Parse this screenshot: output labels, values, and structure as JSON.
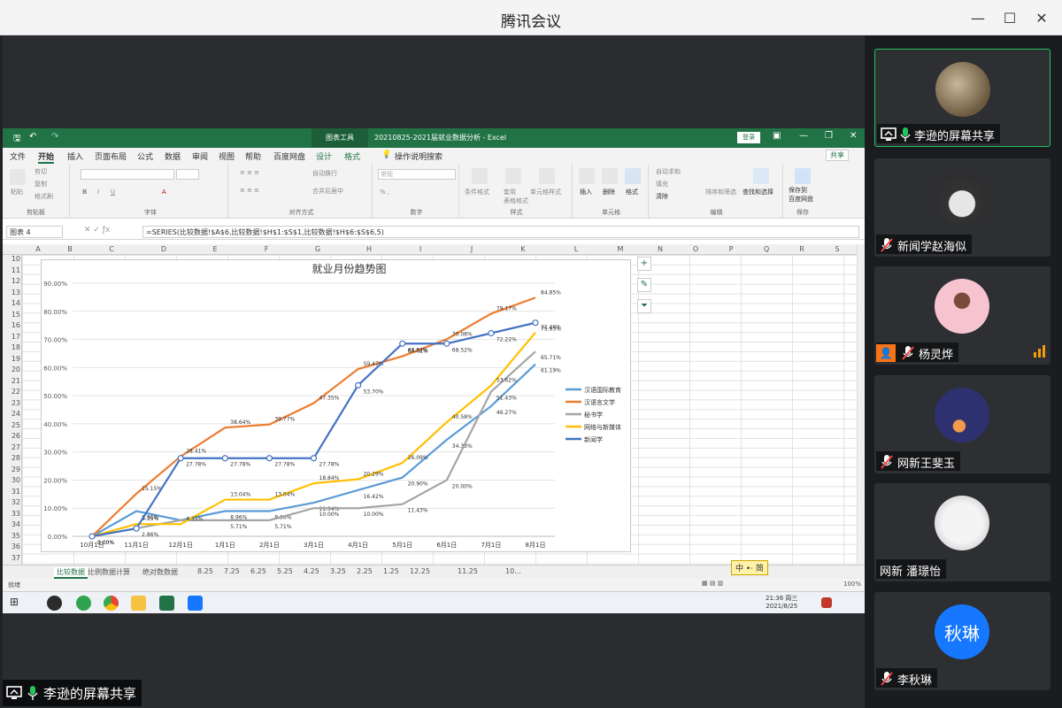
{
  "window": {
    "title": "腾讯会议",
    "minimize_glyph": "—",
    "maximize_glyph": "☐",
    "close_glyph": "✕"
  },
  "excel": {
    "context_tab": "图表工具",
    "doc_title": "20210825-2021届就业数据分析 - Excel",
    "login": "登录",
    "tabs": [
      "文件",
      "开始",
      "插入",
      "页面布局",
      "公式",
      "数据",
      "审阅",
      "视图",
      "帮助",
      "百度网盘",
      "设计",
      "格式"
    ],
    "tell_me": "操作说明搜索",
    "share": "共享",
    "ribbon_groups": [
      "剪贴板",
      "字体",
      "对齐方式",
      "数字",
      "样式",
      "单元格",
      "编辑",
      "保存"
    ],
    "ribbon_buttons": {
      "paste": "粘贴",
      "cut": "剪切",
      "copy": "复制",
      "format_painter": "格式刷",
      "wrap": "自动换行",
      "merge": "合并后居中",
      "number_format": "常规",
      "cond_format": "条件格式",
      "table_format": "套用\n表格格式",
      "cell_style": "单元格样式",
      "insert": "插入",
      "delete": "删除",
      "format": "格式",
      "autosum": "自动求和",
      "fill": "填充",
      "clear": "清除",
      "sort": "排序和筛选",
      "find": "查找和选择",
      "save_baidu": "保存到\n百度网盘"
    },
    "name_box": "图表 4",
    "formula": "=SERIES(比较数据!$A$6,比较数据!$H$1:$S$1,比较数据!$H$6:$S$6,5)",
    "columns": [
      "A",
      "B",
      "C",
      "D",
      "E",
      "F",
      "G",
      "H",
      "I",
      "J",
      "K",
      "L",
      "M",
      "N",
      "O",
      "P",
      "Q",
      "R",
      "S"
    ],
    "rows": [
      "10",
      "11",
      "12",
      "13",
      "14",
      "15",
      "16",
      "17",
      "18",
      "19",
      "20",
      "21",
      "22",
      "23",
      "24",
      "25",
      "26",
      "27",
      "28",
      "29",
      "30",
      "31",
      "32",
      "33",
      "34",
      "35",
      "36",
      "37"
    ],
    "sheet_tabs": [
      "比较数据",
      "比例数据计算",
      "绝对数数据",
      "8.25",
      "7.25",
      "6.25",
      "5.25",
      "4.25",
      "3.25",
      "2.25",
      "1.25",
      "12.25",
      "11.25",
      "10..."
    ],
    "status_left": "就绪",
    "zoom": "100%",
    "ime": "中 •· 简",
    "clock_time": "21:36 周三",
    "clock_date": "2021/8/25"
  },
  "chart_data": {
    "type": "line",
    "title": "就业月份趋势图",
    "categories": [
      "10月1日",
      "11月1日",
      "12月1日",
      "1月1日",
      "2月1日",
      "3月1日",
      "4月1日",
      "5月1日",
      "6月1日",
      "7月1日",
      "8月1日"
    ],
    "ylim": [
      0,
      90
    ],
    "yticks": [
      "0.00%",
      "10.00%",
      "20.00%",
      "30.00%",
      "40.00%",
      "50.00%",
      "60.00%",
      "70.00%",
      "80.00%",
      "90.00%"
    ],
    "grid": true,
    "legend_position": "right",
    "series": [
      {
        "name": "汉语国际教育",
        "color": "#5b9bd5",
        "values": [
          0.0,
          8.96,
          5.71,
          8.96,
          8.96,
          11.94,
          16.42,
          20.9,
          34.33,
          46.27,
          61.19
        ],
        "labels": [
          "0.00%",
          "8.96%",
          "",
          "8.96%",
          "8.96%",
          "11.94%",
          "16.42%",
          "20.90%",
          "34.33%",
          "46.27%",
          "61.19%"
        ]
      },
      {
        "name": "汉语言文学",
        "color": "#ed7d31",
        "values": [
          0.0,
          15.15,
          28.41,
          38.64,
          39.77,
          47.35,
          59.47,
          64.02,
          70.08,
          79.17,
          84.85
        ],
        "labels": [
          "",
          "15.15%",
          "28.41%",
          "38.64%",
          "39.77%",
          "47.35%",
          "59.47%",
          "64.02%",
          "70.08%",
          "79.17%",
          "84.85%"
        ]
      },
      {
        "name": "秘书学",
        "color": "#a5a5a5",
        "values": [
          0.0,
          2.86,
          5.71,
          5.71,
          5.71,
          10.0,
          10.0,
          11.43,
          20.0,
          51.43,
          65.71
        ],
        "labels": [
          "",
          "2.86%",
          "",
          "5.71%",
          "5.71%",
          "10.00%",
          "10.00%",
          "11.43%",
          "20.00%",
          "51.43%",
          "65.71%"
        ]
      },
      {
        "name": "网络与新媒体",
        "color": "#ffc000",
        "values": [
          0.0,
          4.35,
          4.35,
          13.04,
          13.04,
          18.84,
          20.29,
          26.09,
          40.58,
          53.62,
          72.46
        ],
        "labels": [
          "",
          "4.35%",
          "4.35%",
          "13.04%",
          "13.04%",
          "18.84%",
          "20.29%",
          "26.09%",
          "40.58%",
          "53.62%",
          "72.46%"
        ]
      },
      {
        "name": "新闻学",
        "color": "#4472c4",
        "values": [
          0.0,
          2.78,
          27.78,
          27.78,
          27.78,
          27.78,
          53.7,
          68.52,
          68.52,
          72.22,
          75.93
        ],
        "labels": [
          "0.00%",
          "",
          "27.78%",
          "27.78%",
          "27.78%",
          "27.78%",
          "53.70%",
          "68.52%",
          "68.52%",
          "72.22%",
          "75.93%"
        ]
      }
    ]
  },
  "participants": [
    {
      "name": "李逊的屏幕共享",
      "avatar": "photo",
      "mic": "on",
      "share": true,
      "active": true
    },
    {
      "name": "新闻学赵海似",
      "avatar": "anime",
      "mic": "off"
    },
    {
      "name": "杨灵烨",
      "avatar": "pink",
      "mic": "off",
      "signal": true,
      "user_badge": true
    },
    {
      "name": "网新王斐玉",
      "avatar": "night",
      "mic": "off"
    },
    {
      "name": "网新 潘璟怡",
      "avatar": "sketch",
      "mic": "none"
    },
    {
      "name": "李秋琳",
      "avatar_text": "秋琳",
      "avatar_color": "#1677ff",
      "mic": "off"
    }
  ],
  "bottom_label": "李逊的屏幕共享"
}
